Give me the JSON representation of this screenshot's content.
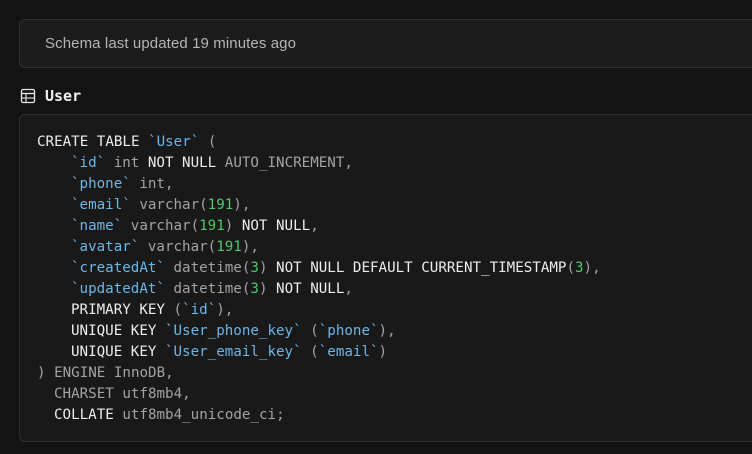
{
  "banner": {
    "text": "Schema last updated 19 minutes ago"
  },
  "table": {
    "icon": "table-icon",
    "name": "User"
  },
  "colors": {
    "background": "#131313",
    "identifier": "#6cb6e8",
    "number": "#4fc96a",
    "muted": "#a3a3a3"
  },
  "sql": {
    "line1": {
      "kw": "CREATE TABLE ",
      "ident": "`User`",
      "rest": " ("
    },
    "col_id": {
      "ident": "`id`",
      "type": " int ",
      "kw": "NOT NULL",
      "rest": " AUTO_INCREMENT,"
    },
    "col_phone": {
      "ident": "`phone`",
      "type": " int,"
    },
    "col_email": {
      "ident": "`email`",
      "type": " varchar(",
      "num": "191",
      "rest": "),"
    },
    "col_name": {
      "ident": "`name`",
      "type": " varchar(",
      "num": "191",
      "close": ") ",
      "kw": "NOT NULL",
      "rest": ","
    },
    "col_avatar": {
      "ident": "`avatar`",
      "type": " varchar(",
      "num": "191",
      "rest": "),"
    },
    "col_createdAt": {
      "ident": "`createdAt`",
      "type": " datetime(",
      "num": "3",
      "close": ") ",
      "kw": "NOT NULL DEFAULT CURRENT_TIMESTAMP",
      "open": "(",
      "num2": "3",
      "rest": "),"
    },
    "col_updatedAt": {
      "ident": "`updatedAt`",
      "type": " datetime(",
      "num": "3",
      "close": ") ",
      "kw": "NOT NULL",
      "rest": ","
    },
    "primary_key": {
      "kw": "PRIMARY KEY",
      "open": " (",
      "ident": "`id`",
      "rest": "),"
    },
    "unique_phone": {
      "kw": "UNIQUE KEY ",
      "ident": "`User_phone_key`",
      "open": " (",
      "ident2": "`phone`",
      "rest": "),"
    },
    "unique_email": {
      "kw": "UNIQUE KEY ",
      "ident": "`User_email_key`",
      "open": " (",
      "ident2": "`email`",
      "rest": ")"
    },
    "engine": {
      "close": ") ",
      "rest": "ENGINE InnoDB,"
    },
    "charset": {
      "rest": "CHARSET utf8mb4,"
    },
    "collate": {
      "kw": "COLLATE",
      "rest": " utf8mb4_unicode_ci;"
    }
  }
}
